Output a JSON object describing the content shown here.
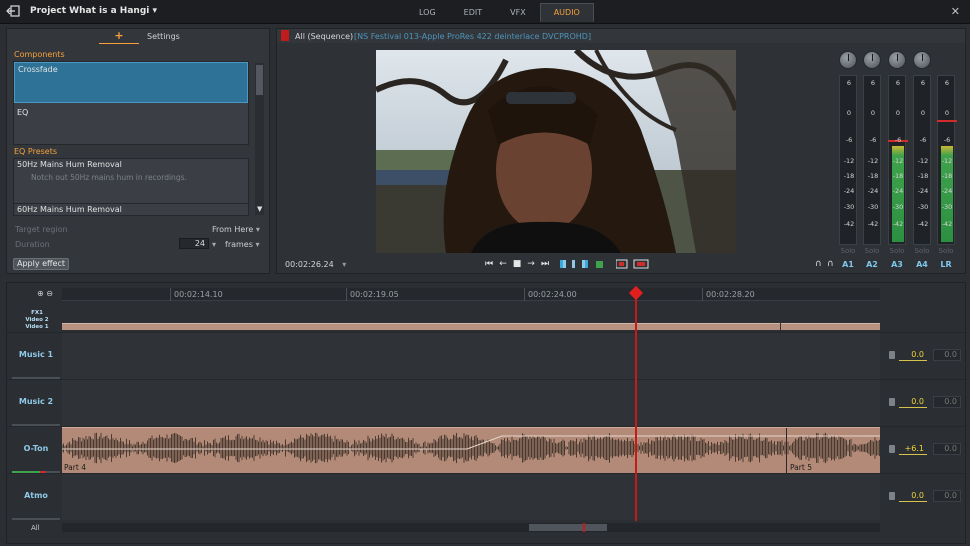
{
  "app": {
    "project_title": "Project What is a Hangi",
    "title_chevron": "▾",
    "tabs": [
      {
        "label": "LOG",
        "active": false
      },
      {
        "label": "EDIT",
        "active": false
      },
      {
        "label": "VFX",
        "active": false
      },
      {
        "label": "AUDIO",
        "active": true
      }
    ],
    "close_glyph": "✕"
  },
  "left_panel": {
    "tab_plus": "+",
    "tab_settings": "Settings",
    "components_title": "Components",
    "components": [
      {
        "label": "Crossfade",
        "selected": true
      },
      {
        "label": "EQ",
        "selected": false
      }
    ],
    "presets_title": "EQ Presets",
    "presets": [
      {
        "label": "50Hz Mains Hum Removal",
        "description": "Notch out 50Hz mains hum in recordings."
      },
      {
        "label": "60Hz Mains Hum Removal",
        "description": ""
      }
    ],
    "target_region_label": "Target region",
    "target_region_value": "From Here",
    "duration_label": "Duration",
    "duration_value": "24",
    "duration_unit": "frames",
    "apply_button": "Apply effect"
  },
  "viewer": {
    "sequence_label": "All (Sequence)",
    "clip_label": "[NS Festival 013-Apple ProRes 422 deinterlace DVCPROHD]",
    "timecode": "00:02:26.24",
    "timecode_chevron": "▾",
    "transport": [
      "⏮",
      "←",
      "■",
      "→",
      "⏭"
    ]
  },
  "meters": {
    "scale": [
      "6",
      "0",
      "-6",
      "-12",
      "-18",
      "-24",
      "-30",
      "-42"
    ],
    "channels": [
      {
        "label": "A1",
        "solo": "Solo",
        "level": 0
      },
      {
        "label": "A2",
        "solo": "Solo",
        "level": 0
      },
      {
        "label": "A3",
        "solo": "Solo",
        "level": 0.58
      },
      {
        "label": "A4",
        "solo": "Solo",
        "level": 0
      },
      {
        "label": "LR",
        "solo": "Solo",
        "level": 0.58
      }
    ],
    "headphone_glyphs": [
      "∩",
      "∩"
    ],
    "colors": {
      "meter_green": "#2b9040",
      "peak_red": "#d12b2b",
      "accent_blue": "#3aa7dd"
    }
  },
  "timeline": {
    "ruler": [
      "00:02:14.10",
      "00:02:19.05",
      "00:02:24.00",
      "00:02:28.20"
    ],
    "video_tracks": [
      "FX1",
      "Video 2",
      "Video 1"
    ],
    "tracks": [
      {
        "name": "Music 1",
        "gain": "0.0",
        "gain2": "0.0",
        "has_clip": false
      },
      {
        "name": "Music 2",
        "gain": "0.0",
        "gain2": "0.0",
        "has_clip": false
      },
      {
        "name": "O-Ton",
        "gain": "+6.1",
        "gain2": "0.0",
        "has_clip": true,
        "clips": [
          "Part 4",
          "Part 5"
        ]
      },
      {
        "name": "Atmo",
        "gain": "0.0",
        "gain2": "0.0",
        "has_clip": false
      }
    ],
    "all_label": "All"
  }
}
